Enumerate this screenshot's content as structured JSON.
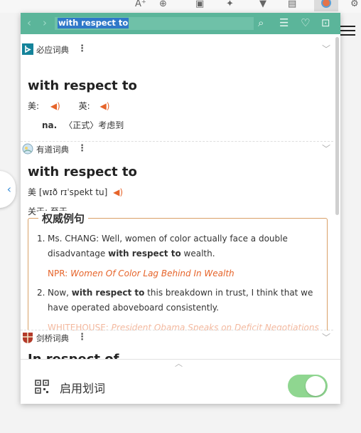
{
  "popup": {
    "search_text": "with respect to",
    "icons": [
      "back-arrow",
      "forward-arrow",
      "search-icon",
      "menu-icon",
      "heart-icon",
      "doc-icon"
    ]
  },
  "dicts": [
    {
      "name": "必应词典",
      "headword": "with respect to",
      "us_label": "美:",
      "uk_label": "英:",
      "pos": "na.",
      "definition": "〈正式〉考虑到"
    },
    {
      "name": "有道词典",
      "headword": "with respect to",
      "phonetic": "美 [wɪð rɪˈspekt tu]",
      "definition": "关于; 至于",
      "authority_title": "权威例句",
      "examples": [
        {
          "num": "1.",
          "before": "Ms. CHANG: Well, women of color actually face a double disadvantage ",
          "bold": "with respect to",
          "after": " wealth.",
          "source_label": "NPR:",
          "source_title": "Women Of Color Lag Behind In Wealth"
        },
        {
          "num": "2.",
          "before": "Now, ",
          "bold": "with respect to",
          "after": " this breakdown in trust, I think that we have operated aboveboard consistently.",
          "source_label": "WHITEHOUSE:",
          "source_title": "President Obama Speaks on Deficit Negotiations"
        }
      ]
    },
    {
      "name": "剑桥词典",
      "headword": "In respect of ..."
    }
  ],
  "footer": {
    "toggle_label": "启用划词",
    "toggle_on": true
  },
  "colors": {
    "topbar": "#5bb59a",
    "accent_orange": "#e6642a",
    "toggle_on": "#8fd690"
  }
}
